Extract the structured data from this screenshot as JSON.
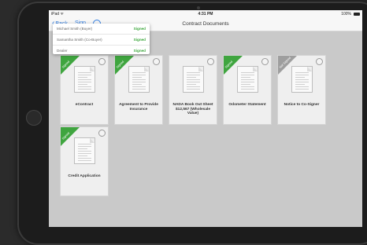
{
  "statusbar": {
    "carrier": "iPad ᯤ",
    "time": "4:31 PM",
    "battery": "100%"
  },
  "navbar": {
    "back_label": "Back",
    "sign_label": "Sign",
    "title": "Contract Documents"
  },
  "signers": [
    {
      "name": "Michael Smith (Buyer)",
      "status": "Signed"
    },
    {
      "name": "Samantha Smith (Co-Buyer)",
      "status": "Signed"
    },
    {
      "name": "Dealer",
      "status": "Signed"
    }
  ],
  "documents": [
    {
      "label": "eContract",
      "ribbon": "Signed",
      "ribbon_color": "#3fa53f"
    },
    {
      "label": "Agreement to Provide Insurance",
      "ribbon": "Signed",
      "ribbon_color": "#3fa53f"
    },
    {
      "label": "NADA Book Out Sheet $12,567 (Wholesale Value)",
      "ribbon": "",
      "ribbon_color": ""
    },
    {
      "label": "Odometer Statement",
      "ribbon": "Signed",
      "ribbon_color": "#3fa53f"
    },
    {
      "label": "Notice to Co-Signer",
      "ribbon": "Not Signed",
      "ribbon_color": "#9e9e9e"
    },
    {
      "label": "Credit Application",
      "ribbon": "Signed",
      "ribbon_color": "#3fa53f"
    }
  ]
}
